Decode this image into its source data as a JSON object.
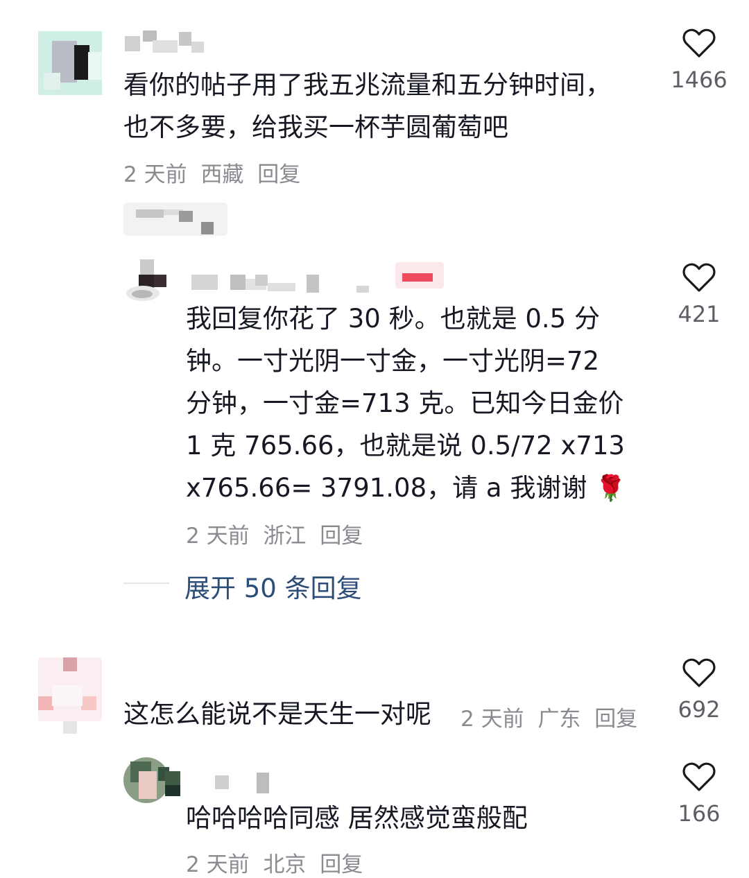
{
  "comments": [
    {
      "text_lines": [
        "看你的帖子用了我五兆流量和五分钟时间，",
        "也不多要，给我买一杯芋圆葡萄吧"
      ],
      "time": "2 天前",
      "location": "西藏",
      "reply_label": "回复",
      "likes": "1466",
      "replies": [
        {
          "text_lines": [
            "我回复你花了 30 秒。也就是 0.5 分",
            "钟。一寸光阴一寸金，一寸光阴=72",
            "分钟，一寸金=713 克。已知今日金价",
            "1 克 765.66，也就是说 0.5/72 x713",
            "x765.66= 3791.08，请 a 我谢谢"
          ],
          "time": "2 天前",
          "location": "浙江",
          "reply_label": "回复",
          "likes": "421"
        }
      ],
      "expand_label": "展开 50 条回复"
    },
    {
      "text": "这怎么能说不是天生一对呢",
      "time": "2 天前",
      "location": "广东",
      "reply_label": "回复",
      "likes": "692",
      "replies": [
        {
          "text": "哈哈哈哈同感 居然感觉蛮般配",
          "time": "2 天前",
          "location": "北京",
          "reply_label": "回复",
          "likes": "166"
        }
      ]
    }
  ],
  "icons": {
    "like": "heart-outline-icon",
    "emoji": "rose-emoji"
  },
  "colors": {
    "text": "#161823",
    "meta": "#8a8b91",
    "link": "#2b4d78"
  }
}
